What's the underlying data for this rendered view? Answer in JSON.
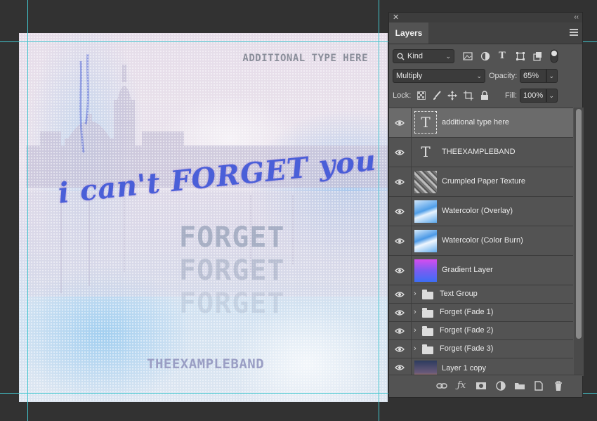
{
  "artwork": {
    "additional_text": "ADDITIONAL TYPE HERE",
    "script_text": "i can't FORGET you",
    "forget_1": "FORGET",
    "forget_2": "FORGET",
    "forget_3": "FORGET",
    "band_name": "THEEXAMPLEBAND"
  },
  "panel": {
    "close_label": "✕",
    "collapse_label": "‹‹",
    "tab_label": "Layers",
    "filter": {
      "value": "Kind"
    },
    "blend_mode": {
      "value": "Multiply"
    },
    "opacity": {
      "label": "Opacity:",
      "value": "65%"
    },
    "lock": {
      "label": "Lock:"
    },
    "fill": {
      "label": "Fill:",
      "value": "100%"
    },
    "layers": [
      {
        "name": "additional type here",
        "kind": "text",
        "selected": true
      },
      {
        "name": "THEEXAMPLEBAND",
        "kind": "text",
        "selected": false
      },
      {
        "name": "Crumpled Paper Texture",
        "kind": "texture",
        "selected": false
      },
      {
        "name": "Watercolor (Overlay)",
        "kind": "watercolor",
        "selected": false
      },
      {
        "name": "Watercolor (Color Burn)",
        "kind": "watercolor",
        "selected": false
      },
      {
        "name": "Gradient Layer",
        "kind": "gradient",
        "selected": false
      },
      {
        "name": "Text Group",
        "kind": "group",
        "selected": false
      },
      {
        "name": "Forget (Fade 1)",
        "kind": "group",
        "selected": false
      },
      {
        "name": "Forget (Fade 2)",
        "kind": "group",
        "selected": false
      },
      {
        "name": "Forget (Fade 3)",
        "kind": "group",
        "selected": false
      },
      {
        "name": "Layer 1 copy",
        "kind": "photo",
        "selected": false
      }
    ]
  },
  "colors": {
    "guide": "#43c6cf",
    "panel_bg": "#535353",
    "selected_row": "#6b6b6b"
  }
}
